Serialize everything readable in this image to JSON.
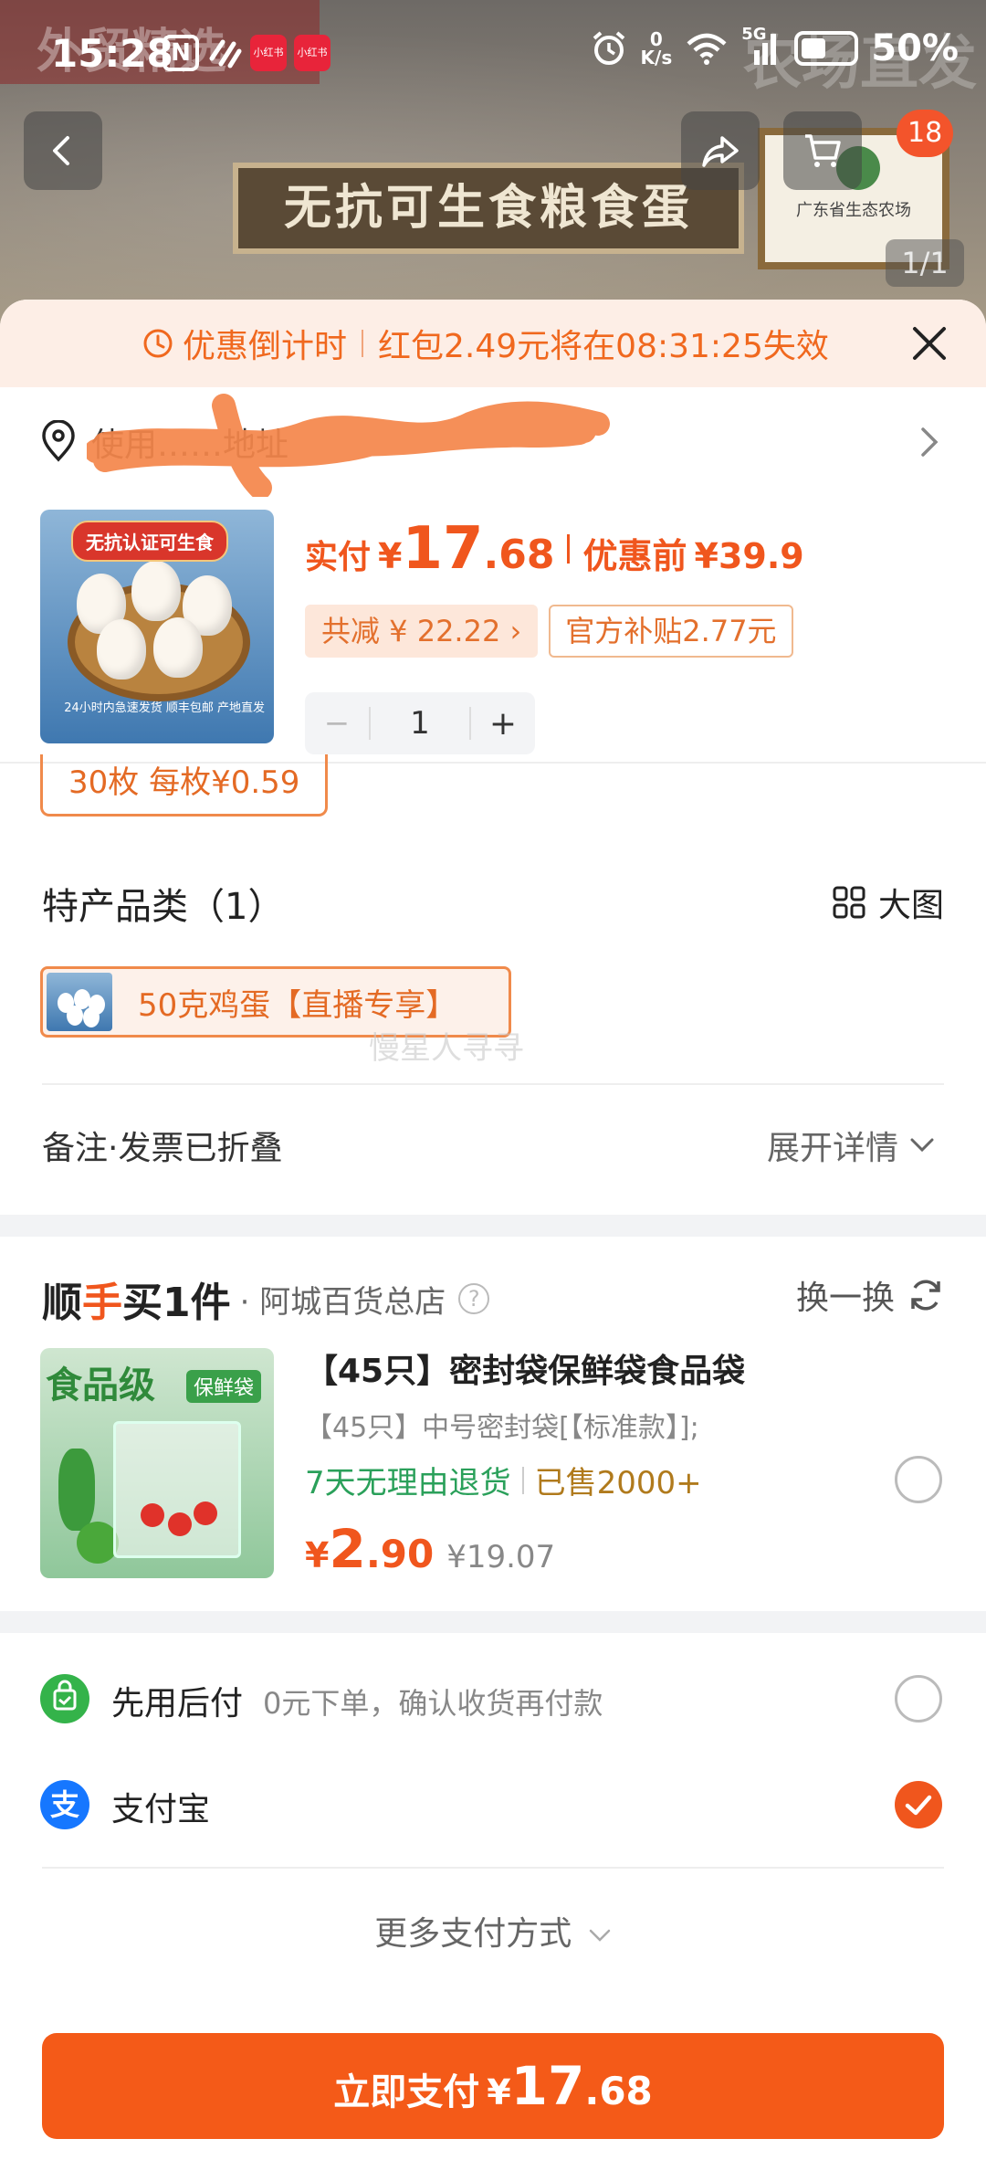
{
  "status_bar": {
    "time": "15:28",
    "n_icon_text": "N",
    "app_icon_text": "小红书",
    "net_speed_value": "0",
    "net_speed_unit": "K/s",
    "signal_text": "5G",
    "battery": "50%"
  },
  "background": {
    "brand_text": "外贸精选",
    "farm_text": "农场直发",
    "sign_text": "无抗可生食粮食蛋",
    "cert_text": "广东省生态农场",
    "cart_badge": "18",
    "image_index": "1/1"
  },
  "countdown": {
    "label": "优惠倒计时",
    "message": "红包2.49元将在08:31:25失效"
  },
  "address": {
    "text": "使用……地址"
  },
  "product": {
    "image_tag": "无抗认证可生食",
    "image_caption": "24小时内急速发货 顺丰包邮 产地直发",
    "paid_label": "实付",
    "currency": "¥",
    "price_int": "17",
    "price_dec": ".68",
    "before_label": "优惠前",
    "before_price": "¥39.9",
    "discount_chip": "共减 ¥ 22.22 ›",
    "subsidy_chip": "官方补贴2.77元",
    "quantity": "1",
    "minus": "−",
    "plus": "+"
  },
  "spec_chip": "30枚  每枚¥0.59",
  "category": {
    "title": "特产品类（1）",
    "view_toggle": "大图",
    "item_label": "50克鸡蛋【直播专享】",
    "watermark": "慢星人寻寻"
  },
  "notes": {
    "label": "备注·发票已折叠",
    "expand": "展开详情"
  },
  "addon": {
    "brand_prefix": "顺",
    "brand_accent": "手",
    "brand_suffix": "买1件",
    "store": "· 阿城百货总店",
    "help": "?",
    "swap": "换一换",
    "image_title": "食品级",
    "image_badge": "保鲜袋",
    "title": "【45只】密封袋保鲜袋食品袋",
    "subtitle": "【45只】中号密封袋[【标准款】];",
    "return_policy": "7天无理由退货",
    "sold": "已售2000+",
    "currency": "¥",
    "price_int": "2",
    "price_dec": ".90",
    "old_price": "¥19.07"
  },
  "payment": {
    "later_name": "先用后付",
    "later_desc": "0元下单，确认收货再付款",
    "alipay_name": "支付宝",
    "alipay_symbol": "支",
    "more": "更多支付方式"
  },
  "pay_button": {
    "label": "立即支付",
    "currency": "¥",
    "price_int": "17",
    "price_dec": ".68"
  },
  "colors": {
    "accent": "#f45a18",
    "countdown_bg": "#fdeee6",
    "green": "#2aa05a",
    "alipay_blue": "#1677ff"
  }
}
